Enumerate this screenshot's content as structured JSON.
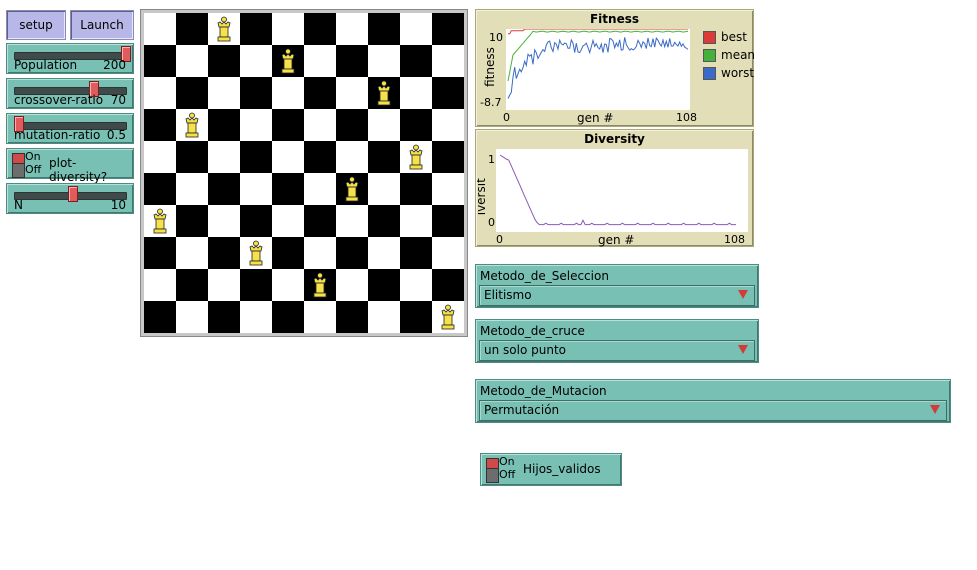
{
  "buttons": {
    "setup": "setup",
    "launch": "Launch"
  },
  "sliders": [
    {
      "label": "Population",
      "value": "200",
      "fraction": 1.0
    },
    {
      "label": "crossover-ratio",
      "value": "70",
      "fraction": 0.7
    },
    {
      "label": "mutation-ratio",
      "value": "0.5",
      "fraction": 0.0
    },
    {
      "label": "N",
      "value": "10",
      "fraction": 0.5
    }
  ],
  "switches": {
    "plot_diversity": {
      "on": "On",
      "off": "Off",
      "label": "plot-diversity?",
      "state": "on"
    },
    "hijos_validos": {
      "on": "On",
      "off": "Off",
      "label": "Hijos_validos",
      "state": "on"
    }
  },
  "board": {
    "size": 10,
    "queen_columns_by_row": [
      2,
      4,
      7,
      1,
      8,
      6,
      0,
      3,
      5,
      9
    ],
    "colors": {
      "dark": "#000000",
      "light": "#ffffff",
      "queen": "#f5e14a"
    }
  },
  "plots": {
    "fitness": {
      "title": "Fitness",
      "xlabel": "gen #",
      "ylabel": "fitness",
      "x_min": "0",
      "x_max": "108",
      "y_max": "10",
      "y_min": "-8.7",
      "legend": [
        {
          "name": "best",
          "color": "#d93a3a"
        },
        {
          "name": "mean",
          "color": "#45b13b"
        },
        {
          "name": "worst",
          "color": "#3b6bc7"
        }
      ]
    },
    "diversity": {
      "title": "Diversity",
      "xlabel": "gen #",
      "ylabel": "diversity",
      "x_min": "0",
      "x_max": "108",
      "y_max": "1",
      "y_min": "0",
      "color": "#8a5ab5"
    }
  },
  "choosers": {
    "seleccion": {
      "label": "Metodo_de_Seleccion",
      "value": "Elitismo"
    },
    "cruce": {
      "label": "Metodo_de_cruce",
      "value": "un solo punto"
    },
    "mutacion": {
      "label": "Metodo_de_Mutacion",
      "value": "Permutación"
    }
  }
}
